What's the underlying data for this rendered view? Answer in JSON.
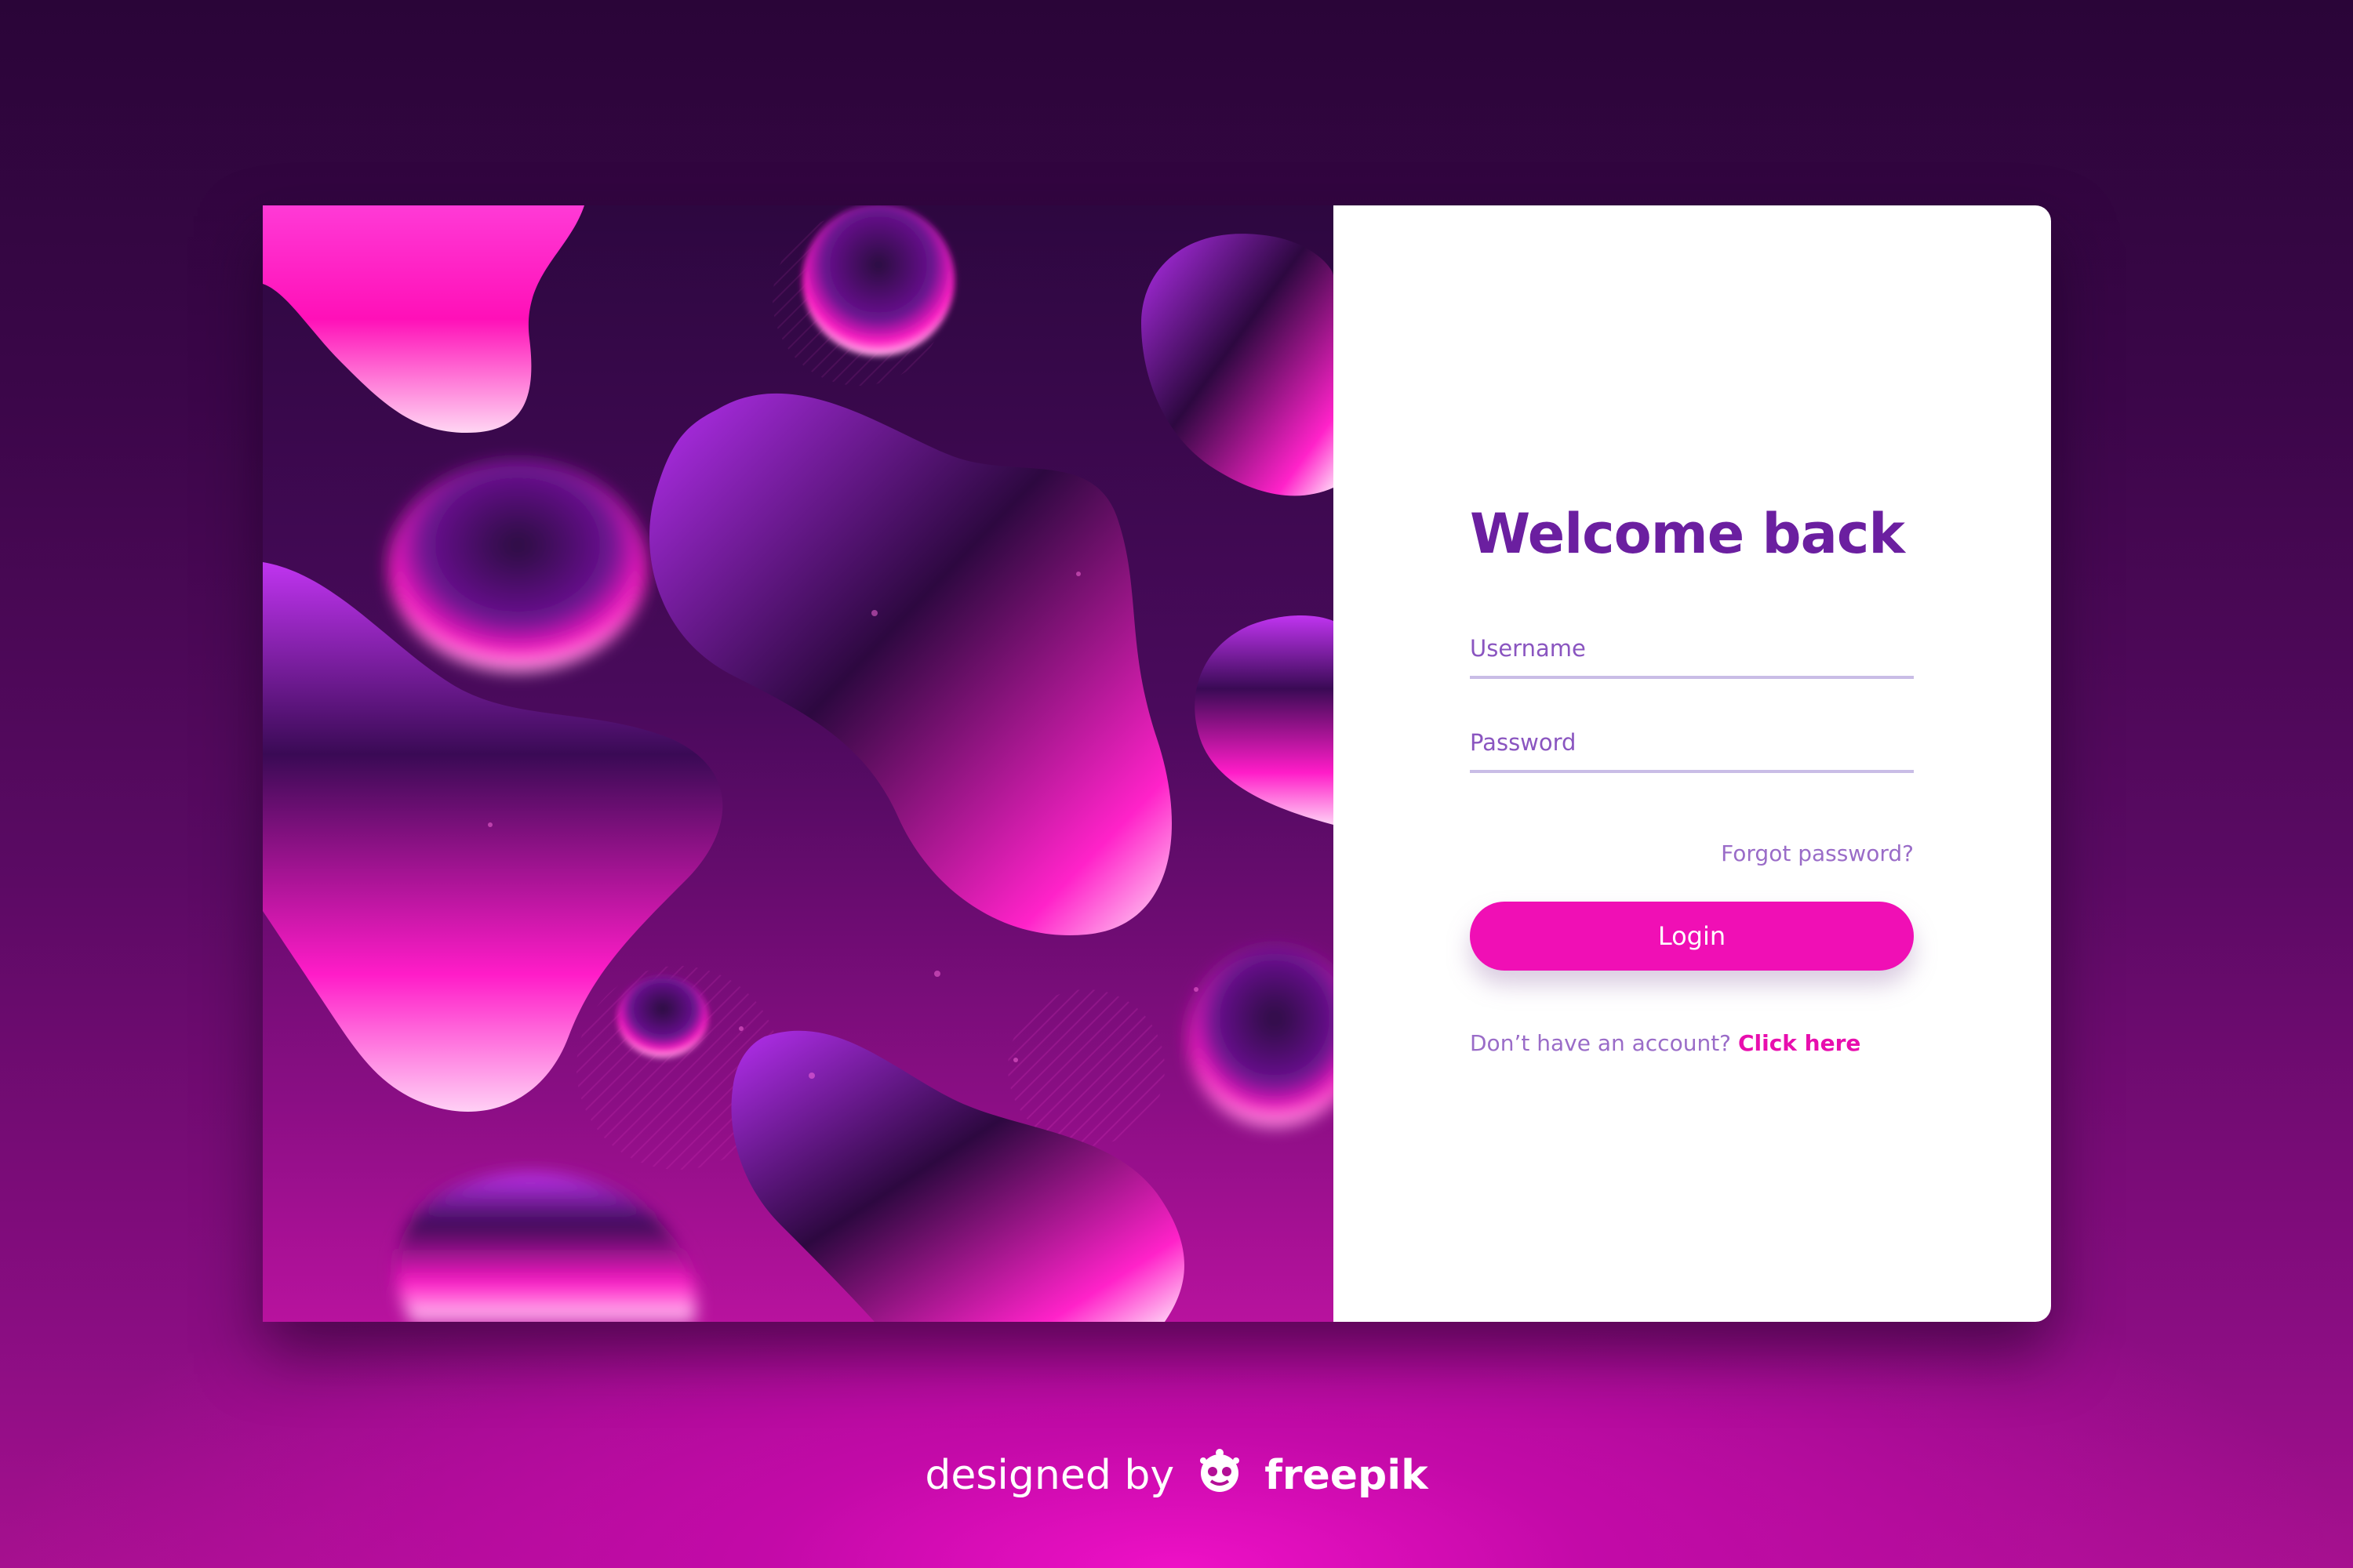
{
  "login_form": {
    "title": "Welcome back",
    "username_placeholder": "Username",
    "password_placeholder": "Password",
    "forgot_password_label": "Forgot password?",
    "login_button_label": "Login",
    "signup_prompt": "Don’t have an account?",
    "signup_link_label": "Click here"
  },
  "credit": {
    "prefix": "designed by",
    "brand": "freepik",
    "logo_icon": "freepik-logo-icon"
  },
  "colors": {
    "accent": "#f00fb5",
    "title": "#6b1fa0",
    "background_dark": "#2a0538",
    "background_glow": "#ee10c6"
  },
  "icons": {
    "illustration": "fluid-blobs-illustration"
  }
}
